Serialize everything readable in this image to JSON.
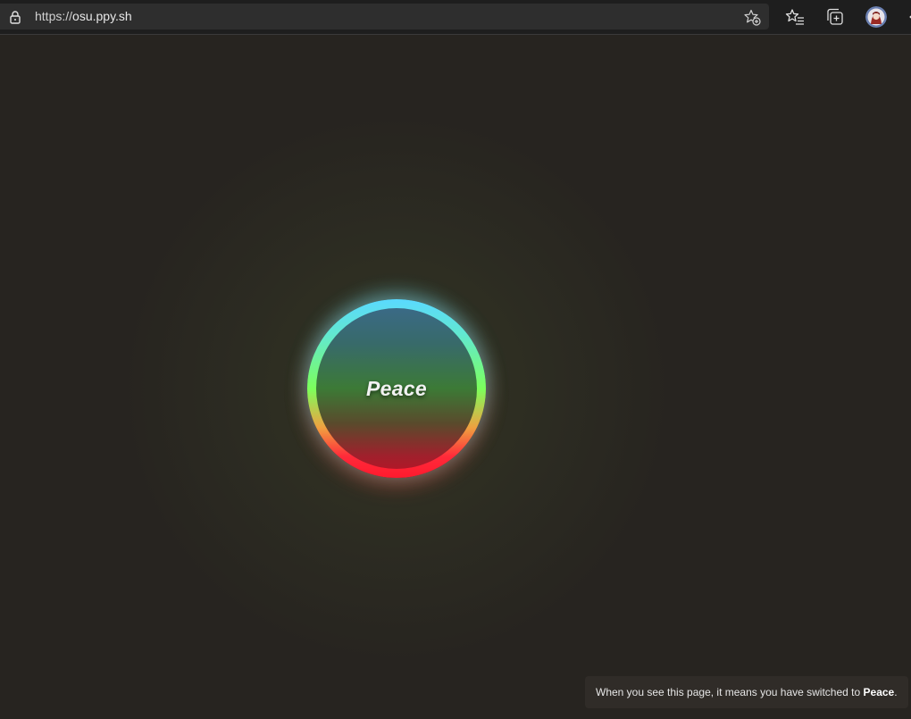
{
  "browser": {
    "url_protocol": "https://",
    "url_host": "osu.ppy.sh",
    "icons": {
      "lock": "lock-icon",
      "add_favorite": "star-plus-icon",
      "favorites": "favorites-list-icon",
      "collections": "collections-icon",
      "profile": "profile-avatar"
    }
  },
  "main": {
    "mode_label": "Peace",
    "ring_colors": {
      "top": "#5ad9ff",
      "middle": "#7cff5c",
      "bottom": "#ff1a2e"
    },
    "background_color": "#272420"
  },
  "toast": {
    "message_prefix": "When you see this page, it means you have switched to ",
    "mode_name": "Peace",
    "message_suffix": "."
  }
}
